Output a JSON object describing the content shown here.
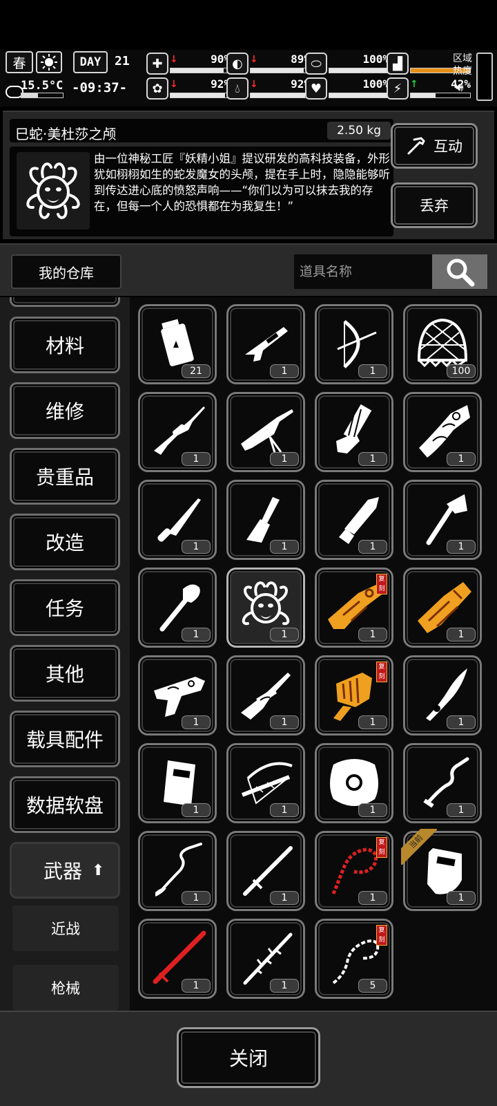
{
  "status": {
    "season": "春",
    "temperature": "15.5°C",
    "day_label": "DAY",
    "day_number": "21",
    "time": "-09:37-",
    "zone_heat_label": "区域\n热度",
    "stats": [
      {
        "icon": "medkit-icon",
        "trend": "down",
        "value": "90%",
        "level": 0.9
      },
      {
        "icon": "stomach-icon",
        "trend": "down",
        "value": "89%",
        "level": 0.89
      },
      {
        "icon": "pill-icon",
        "trend": "none",
        "value": "100%",
        "level": 1.0
      },
      {
        "icon": "brain-icon",
        "trend": "down",
        "value": "92%",
        "level": 0.92
      },
      {
        "icon": "water-drop-icon",
        "trend": "down",
        "value": "92%",
        "level": 0.92
      },
      {
        "icon": "heart-icon",
        "trend": "none",
        "value": "100%",
        "level": 1.0
      },
      {
        "icon": "boot-icon",
        "trend": "none",
        "value": "",
        "level": 0.0
      },
      {
        "icon": "stamina-icon",
        "trend": "up",
        "value": "42%",
        "level": 0.42
      }
    ],
    "colors": {
      "down": "#ff2a2a",
      "up": "#1fcc3a"
    }
  },
  "detail": {
    "name": "巳蛇·美杜莎之颅",
    "weight": "2.50 kg",
    "description": "由一位神秘工匠『妖精小姐』提议研发的高科技装备，外形犹如栩栩如生的蛇发魔女的头颅，提在手上时，隐隐能够听到传达进心底的愤怒声响——“你们以为可以抹去我的存在，但每一个人的恐惧都在为我复生！”",
    "interact_label": "互动",
    "discard_label": "丢弃"
  },
  "warehouse": {
    "tab_label": "我的仓库",
    "search_placeholder": "道具名称"
  },
  "categories": [
    "材料",
    "维修",
    "贵重品",
    "改造",
    "任务",
    "其他",
    "载具配件",
    "数据软盘",
    "武器"
  ],
  "subcategories": [
    "近战",
    "枪械"
  ],
  "items": [
    {
      "icon": "explosive-canister-icon",
      "qty": "21",
      "color": "#fff"
    },
    {
      "icon": "shotgun-icon",
      "qty": "1",
      "color": "#fff"
    },
    {
      "icon": "compound-bow-icon",
      "qty": "1",
      "color": "#fff"
    },
    {
      "icon": "net-icon",
      "qty": "100",
      "color": "#fff"
    },
    {
      "icon": "sniper-rifle-icon",
      "qty": "1",
      "color": "#fff"
    },
    {
      "icon": "machine-gun-icon",
      "qty": "1",
      "color": "#fff"
    },
    {
      "icon": "minigun-icon",
      "qty": "1",
      "color": "#fff"
    },
    {
      "icon": "ornate-launcher-icon",
      "qty": "1",
      "color": "#fff"
    },
    {
      "icon": "combat-knife-icon",
      "qty": "1",
      "color": "#fff"
    },
    {
      "icon": "chisel-icon",
      "qty": "1",
      "color": "#fff"
    },
    {
      "icon": "machete-icon",
      "qty": "1",
      "color": "#fff"
    },
    {
      "icon": "hatchet-icon",
      "qty": "1",
      "color": "#fff"
    },
    {
      "icon": "shovel-icon",
      "qty": "1",
      "color": "#fff"
    },
    {
      "icon": "medusa-head-icon",
      "qty": "1",
      "color": "#fff",
      "selected": true
    },
    {
      "icon": "golden-gun-icon",
      "qty": "1",
      "color": "#f0a020",
      "tag": "复刻"
    },
    {
      "icon": "golden-gauntlet-icon",
      "qty": "1",
      "color": "#f0a020"
    },
    {
      "icon": "ornate-pistol-icon",
      "qty": "1",
      "color": "#fff"
    },
    {
      "icon": "ornate-rifle-icon",
      "qty": "1",
      "color": "#fff"
    },
    {
      "icon": "golden-claw-gun-icon",
      "qty": "1",
      "color": "#f0a020",
      "tag": "复刻"
    },
    {
      "icon": "curved-blade-icon",
      "qty": "1",
      "color": "#fff"
    },
    {
      "icon": "riot-shield-small-icon",
      "qty": "1",
      "color": "#fff"
    },
    {
      "icon": "crossbow-icon",
      "qty": "1",
      "color": "#fff"
    },
    {
      "icon": "round-shield-icon",
      "qty": "1",
      "color": "#fff"
    },
    {
      "icon": "wavy-sword-icon",
      "qty": "1",
      "color": "#fff"
    },
    {
      "icon": "serpent-spear-icon",
      "qty": "1",
      "color": "#fff"
    },
    {
      "icon": "katana-icon",
      "qty": "1",
      "color": "#fff"
    },
    {
      "icon": "red-chain-whip-icon",
      "qty": "1",
      "color": "#e02020",
      "tag": "复刻"
    },
    {
      "icon": "riot-shield-icon",
      "qty": "1",
      "color": "#fff",
      "ribbon": "当前"
    },
    {
      "icon": "red-blade-icon",
      "qty": "1",
      "color": "#e02020"
    },
    {
      "icon": "thorn-staff-icon",
      "qty": "1",
      "color": "#fff"
    },
    {
      "icon": "bone-whip-icon",
      "qty": "5",
      "color": "#fff",
      "tag": "复刻"
    }
  ],
  "close_label": "关闭"
}
